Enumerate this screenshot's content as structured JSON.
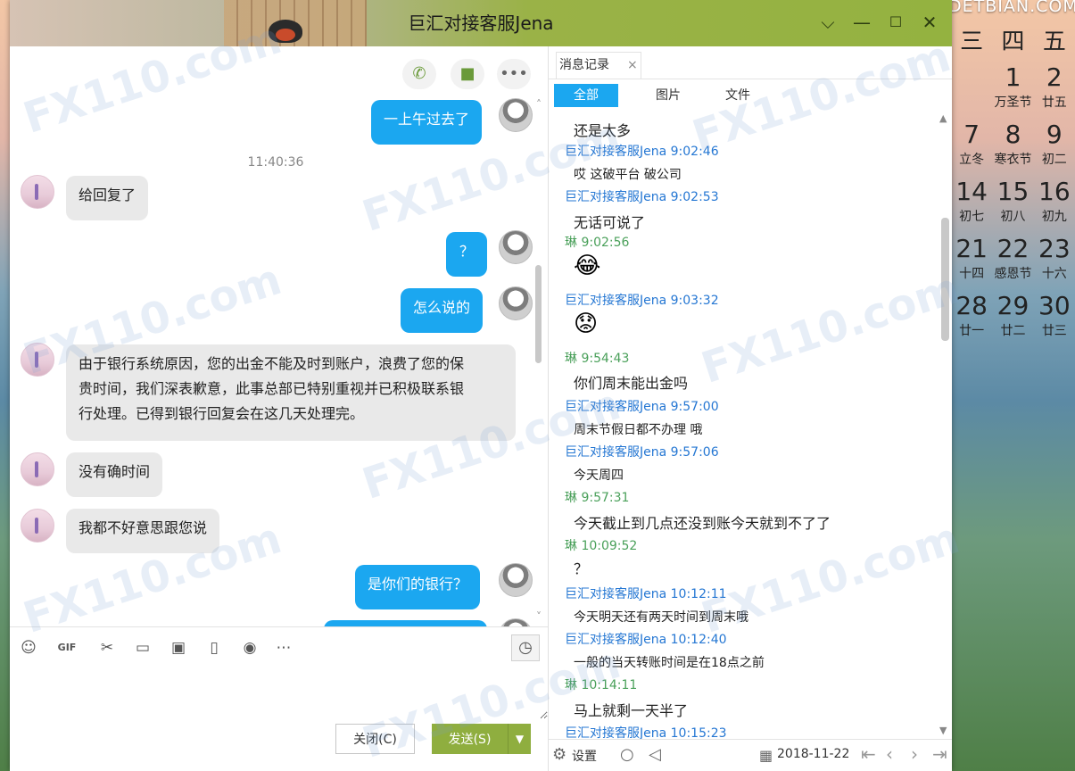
{
  "window": {
    "title": "巨汇对接客服Jena",
    "minimize_icon": "chevron-down",
    "controls": [
      "chevron-down",
      "minimize",
      "maximize",
      "close"
    ]
  },
  "desktop": {
    "site_text": "DETBIAN.COM",
    "calendar": {
      "weekdays": [
        "三",
        "四",
        "五"
      ],
      "rows": [
        [
          {
            "n": "",
            "l": ""
          },
          {
            "n": "1",
            "l": "万圣节"
          },
          {
            "n": "2",
            "l": "廿五"
          }
        ],
        [
          {
            "n": "7",
            "l": "立冬"
          },
          {
            "n": "8",
            "l": "寒衣节"
          },
          {
            "n": "9",
            "l": "初二"
          }
        ],
        [
          {
            "n": "14",
            "l": "初七"
          },
          {
            "n": "15",
            "l": "初八"
          },
          {
            "n": "16",
            "l": "初九"
          }
        ],
        [
          {
            "n": "21",
            "l": "十四"
          },
          {
            "n": "22",
            "l": "感恩节"
          },
          {
            "n": "23",
            "l": "十六"
          }
        ],
        [
          {
            "n": "28",
            "l": "廿一"
          },
          {
            "n": "29",
            "l": "廿二"
          },
          {
            "n": "30",
            "l": "廿三"
          }
        ]
      ]
    }
  },
  "chat": {
    "timestamp": "11:40:36",
    "messages": [
      {
        "from": "me",
        "text": "一上午过去了"
      },
      {
        "from": "agent",
        "text": "给回复了"
      },
      {
        "from": "me",
        "text": "？"
      },
      {
        "from": "me",
        "text": "怎么说的"
      },
      {
        "from": "agent",
        "line1": "由于银行系统原因，您的出金不能及时到账户，浪费了您的保",
        "line2": "贵时间，我们深表歉意，此事总部已特别重视并已积极联系银",
        "line3": "行处理。已得到银行回复会在这几天处理完。"
      },
      {
        "from": "agent",
        "text": "没有确时间"
      },
      {
        "from": "agent",
        "text": "我都不好意思跟您说"
      },
      {
        "from": "me",
        "text": "是你们的银行？"
      }
    ]
  },
  "input": {
    "placeholder": "",
    "close_label": "关闭(C)",
    "send_label": "发送(S)"
  },
  "history": {
    "tab_label": "消息记录",
    "filters": [
      "全部",
      "图片",
      "文件"
    ],
    "items": [
      {
        "type": "msg",
        "text": "还是太多"
      },
      {
        "type": "agent",
        "text": "巨汇对接客服Jena 9:02:46"
      },
      {
        "type": "msg",
        "text": "哎 这破平台 破公司"
      },
      {
        "type": "agent",
        "text": "巨汇对接客服Jena 9:02:53"
      },
      {
        "type": "msg",
        "text": "无话可说了"
      },
      {
        "type": "me",
        "text": "琳 9:02:56"
      },
      {
        "type": "emoji",
        "text": "😂"
      },
      {
        "type": "agent",
        "text": "巨汇对接客服Jena 9:03:32"
      },
      {
        "type": "emoji",
        "text": "😟"
      },
      {
        "type": "me",
        "text": "琳 9:54:43"
      },
      {
        "type": "msg",
        "text": "你们周末能出金吗"
      },
      {
        "type": "agent",
        "text": "巨汇对接客服Jena 9:57:00"
      },
      {
        "type": "msg",
        "text": "周末节假日都不办理 哦"
      },
      {
        "type": "agent",
        "text": "巨汇对接客服Jena 9:57:06"
      },
      {
        "type": "msg",
        "text": "今天周四"
      },
      {
        "type": "me",
        "text": "琳 9:57:31"
      },
      {
        "type": "msg",
        "text": "今天截止到几点还没到账今天就到不了了"
      },
      {
        "type": "me",
        "text": "琳 10:09:52"
      },
      {
        "type": "msg",
        "text": "？"
      },
      {
        "type": "agent",
        "text": "巨汇对接客服Jena 10:12:11"
      },
      {
        "type": "msg",
        "text": "今天明天还有两天时间到周末哦"
      },
      {
        "type": "agent",
        "text": "巨汇对接客服Jena 10:12:40"
      },
      {
        "type": "msg",
        "text": "一般的当天转账时间是在18点之前"
      },
      {
        "type": "me",
        "text": "琳 10:14:11"
      },
      {
        "type": "msg",
        "text": "马上就剩一天半了"
      },
      {
        "type": "agent",
        "text": "巨汇对接客服Jena 10:15:23"
      }
    ],
    "settings_label": "设置",
    "date": "2018-11-22"
  },
  "watermark": "FX110.com"
}
